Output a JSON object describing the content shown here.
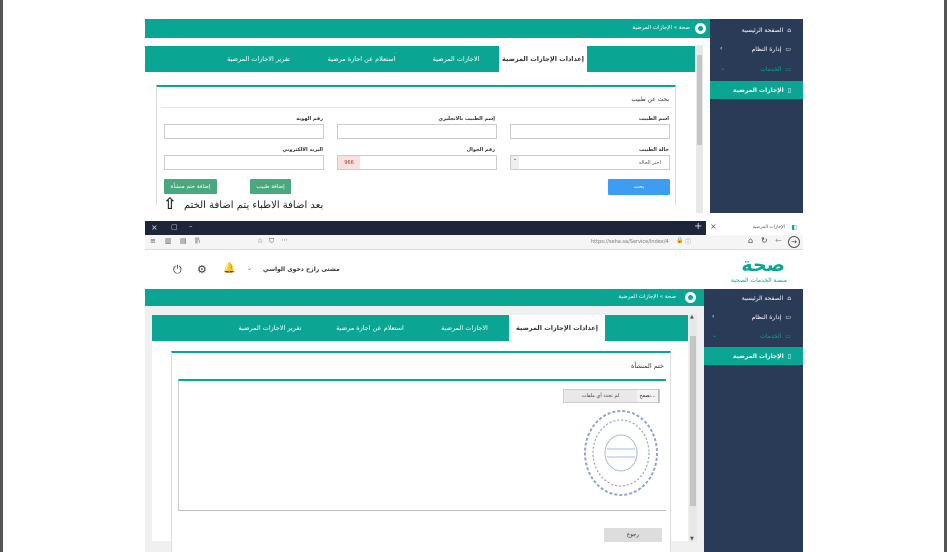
{
  "top": {
    "breadcrumb": "صحة  »  الإجازات المرضية",
    "sidebar": {
      "home": "الصفحة الرئيسية",
      "system": "إدارة النظام",
      "services": "الخدمات",
      "sick_leaves": "الإجازات المرضية"
    },
    "tabs": [
      "إعدادات الإجازات المرضية",
      "الاجازات المرضية",
      "استعلام عن اجازة مرضية",
      "تقرير الاجازات المرضية"
    ],
    "section_title": "بحث عن طبيب",
    "labels": {
      "doctor_name": "اسم الطبيب",
      "doctor_name_en": "إسم الطبيب بالانجليزي",
      "id_number": "رقم الهوية",
      "doctor_status": "حالة الطبيب",
      "mobile": "رقم الجوال",
      "email": "البريد الالكتروني"
    },
    "status_select": "اختر الحالة",
    "mobile_prefix": "966",
    "buttons": {
      "search": "بحث",
      "add_doctor": "إضافة طبيب",
      "add_stamp": "إضافة ختم منشأة"
    }
  },
  "annotation": "بعد اضافة الاطباء يتم اضافة الختم",
  "browser": {
    "tab_title": "الإجازات المرضية",
    "url": "https://seha.sa/Service/Index/4",
    "new_tab": "+",
    "close": "×"
  },
  "bottom": {
    "user_name": "مشتى رازح دخوى الواسي",
    "logo_text": "صحة",
    "logo_sub": "منصة الخدمات الصحية",
    "breadcrumb": "صحة  »  الإجازات المرضية",
    "sidebar": {
      "home": "الصفحة الرئيسية",
      "system": "إدارة النظام",
      "services": "الخدمات",
      "sick_leaves": "الإجازات المرضية"
    },
    "tabs": [
      "إعدادات الإجازات المرضية",
      "الاجازات المرضية",
      "استعلام عن اجازة مرضية",
      "تقرير الاجازات المرضية"
    ],
    "section_title": "ختم المنشأة",
    "file_button": "تصفح...",
    "file_status": "لم تحدد أي ملفات",
    "back_button": "رجوع"
  },
  "colors": {
    "teal": "#0ba593",
    "sidebar": "#2a3b57",
    "button": "#3d9df0",
    "green_button": "#4aa87e",
    "stamp": "#8fa3d4"
  }
}
